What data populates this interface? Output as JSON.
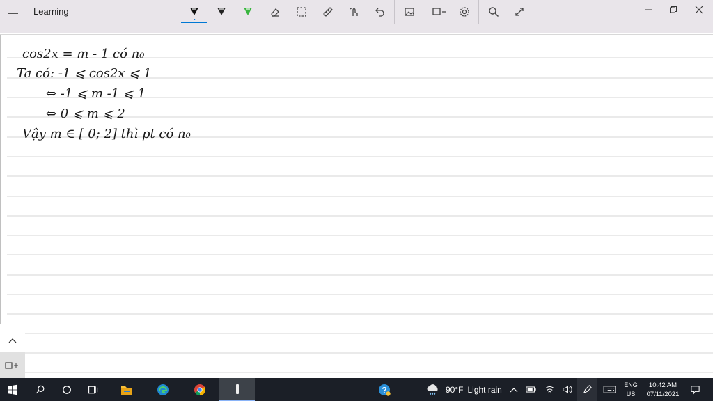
{
  "app": {
    "title": "Learning"
  },
  "colors": {
    "accent": "#0078d4",
    "highlighter": "#3ab540",
    "ink": "#1a1a1a",
    "taskbar": "#1b1f27"
  },
  "toolbar": [
    {
      "name": "ballpoint-pen-icon",
      "tooltip": "Ballpoint pen"
    },
    {
      "name": "pencil-icon",
      "tooltip": "Pencil"
    },
    {
      "name": "highlighter-icon",
      "tooltip": "Highlighter"
    },
    {
      "name": "eraser-icon",
      "tooltip": "Eraser"
    },
    {
      "name": "lasso-select-icon",
      "tooltip": "Lasso select"
    },
    {
      "name": "ruler-icon",
      "tooltip": "Ruler"
    },
    {
      "name": "touch-writing-icon",
      "tooltip": "Touch writing"
    },
    {
      "name": "undo-icon",
      "tooltip": "Undo"
    },
    {
      "name": "add-image-icon",
      "tooltip": "Add image"
    },
    {
      "name": "crop-icon",
      "tooltip": "Crop"
    },
    {
      "name": "settings-icon",
      "tooltip": "Settings"
    },
    {
      "name": "zoom-icon",
      "tooltip": "Zoom"
    },
    {
      "name": "full-screen-icon",
      "tooltip": "Full screen"
    }
  ],
  "notes": {
    "line1": "cos2x = m - 1  có n₀",
    "line2": "Ta có: -1 ⩽ cos2x ⩽ 1",
    "line3": "⇔  -1 ⩽  m -1  ⩽ 1",
    "line4": "⇔   0 ⩽  m  ⩽ 2",
    "line5": "Vậy  m ∈ [ 0; 2]  thì pt  có n₀"
  },
  "taskbar": {
    "apps": [
      {
        "name": "start-icon"
      },
      {
        "name": "search-icon"
      },
      {
        "name": "cortana-icon"
      },
      {
        "name": "task-view-icon"
      },
      {
        "name": "file-explorer-icon"
      },
      {
        "name": "edge-icon"
      },
      {
        "name": "chrome-icon"
      },
      {
        "name": "whiteboard-app-icon"
      }
    ],
    "weather": {
      "temp": "90°F",
      "condition": "Light rain"
    },
    "language": {
      "line1": "ENG",
      "line2": "US"
    },
    "clock": {
      "time": "10:42 AM",
      "date": "07/11/2021"
    }
  }
}
